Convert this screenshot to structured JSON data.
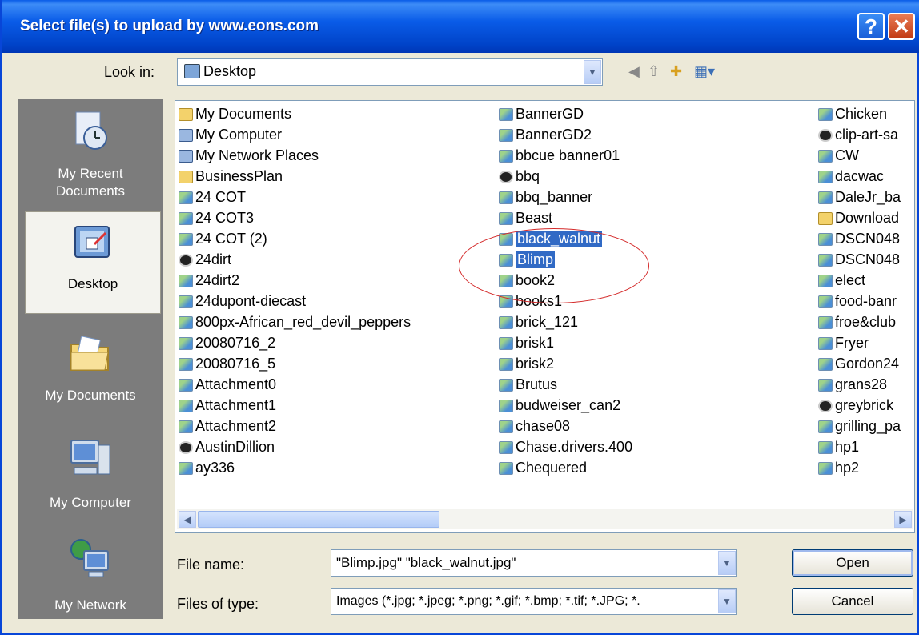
{
  "window": {
    "title": "Select file(s) to upload by www.eons.com",
    "help_glyph": "?",
    "close_glyph": "✕"
  },
  "look_in": {
    "label": "Look in:",
    "value": "Desktop"
  },
  "places": [
    {
      "label": "My Recent\nDocuments",
      "icon": "recent-documents-icon"
    },
    {
      "label": "Desktop",
      "icon": "desktop-icon"
    },
    {
      "label": "My Documents",
      "icon": "my-documents-icon"
    },
    {
      "label": "My Computer",
      "icon": "my-computer-icon"
    },
    {
      "label": "My Network",
      "icon": "my-network-icon"
    }
  ],
  "files": {
    "col1": [
      {
        "name": "My Documents",
        "icon": "folder"
      },
      {
        "name": "My Computer",
        "icon": "pc"
      },
      {
        "name": "My Network Places",
        "icon": "pc"
      },
      {
        "name": "BusinessPlan",
        "icon": "folder"
      },
      {
        "name": "24 COT",
        "icon": "img"
      },
      {
        "name": "24 COT3",
        "icon": "img"
      },
      {
        "name": "24 COT (2)",
        "icon": "img"
      },
      {
        "name": "24dirt",
        "icon": "disc"
      },
      {
        "name": "24dirt2",
        "icon": "img"
      },
      {
        "name": "24dupont-diecast",
        "icon": "img"
      },
      {
        "name": "800px-African_red_devil_peppers",
        "icon": "img"
      },
      {
        "name": "20080716_2",
        "icon": "img"
      },
      {
        "name": "20080716_5",
        "icon": "img"
      },
      {
        "name": "Attachment0",
        "icon": "img"
      },
      {
        "name": "Attachment1",
        "icon": "img"
      },
      {
        "name": "Attachment2",
        "icon": "img"
      },
      {
        "name": "AustinDillion",
        "icon": "disc"
      },
      {
        "name": "ay336",
        "icon": "img"
      }
    ],
    "col2": [
      {
        "name": "BannerGD",
        "icon": "img"
      },
      {
        "name": "BannerGD2",
        "icon": "img"
      },
      {
        "name": "bbcue banner01",
        "icon": "img"
      },
      {
        "name": "bbq",
        "icon": "disc"
      },
      {
        "name": "bbq_banner",
        "icon": "img"
      },
      {
        "name": "Beast",
        "icon": "img"
      },
      {
        "name": "black_walnut",
        "icon": "img",
        "selected": true
      },
      {
        "name": "Blimp",
        "icon": "img",
        "selected": true
      },
      {
        "name": "book2",
        "icon": "img"
      },
      {
        "name": "books1",
        "icon": "img"
      },
      {
        "name": "brick_121",
        "icon": "img"
      },
      {
        "name": "brisk1",
        "icon": "img"
      },
      {
        "name": "brisk2",
        "icon": "img"
      },
      {
        "name": "Brutus",
        "icon": "img"
      },
      {
        "name": "budweiser_can2",
        "icon": "img"
      },
      {
        "name": "chase08",
        "icon": "img"
      },
      {
        "name": "Chase.drivers.400",
        "icon": "img"
      },
      {
        "name": "Chequered",
        "icon": "img"
      }
    ],
    "col3": [
      {
        "name": "Chicken",
        "icon": "img"
      },
      {
        "name": "clip-art-sa",
        "icon": "disc"
      },
      {
        "name": "CW",
        "icon": "img"
      },
      {
        "name": "dacwac",
        "icon": "img"
      },
      {
        "name": "DaleJr_ba",
        "icon": "img"
      },
      {
        "name": "Download",
        "icon": "folder"
      },
      {
        "name": "DSCN048",
        "icon": "img"
      },
      {
        "name": "DSCN048",
        "icon": "img"
      },
      {
        "name": "elect",
        "icon": "img"
      },
      {
        "name": "food-banr",
        "icon": "img"
      },
      {
        "name": "froe&club",
        "icon": "img"
      },
      {
        "name": "Fryer",
        "icon": "img"
      },
      {
        "name": "Gordon24",
        "icon": "img"
      },
      {
        "name": "grans28",
        "icon": "img"
      },
      {
        "name": "greybrick",
        "icon": "disc"
      },
      {
        "name": "grilling_pa",
        "icon": "img"
      },
      {
        "name": "hp1",
        "icon": "img"
      },
      {
        "name": "hp2",
        "icon": "img"
      }
    ]
  },
  "file_name": {
    "label": "File name:",
    "value": "\"Blimp.jpg\" \"black_walnut.jpg\""
  },
  "file_type": {
    "label": "Files of type:",
    "value": "Images (*.jpg; *.jpeg; *.png; *.gif; *.bmp; *.tif; *.JPG; *."
  },
  "buttons": {
    "open": "Open",
    "cancel": "Cancel"
  },
  "colors": {
    "titlebar": "#0a5ce8",
    "selection": "#316ac5",
    "annotation": "#d42a2a"
  }
}
